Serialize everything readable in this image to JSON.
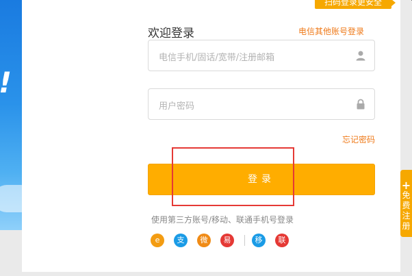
{
  "header": {
    "qr_tip": "扫码登录更安全"
  },
  "login": {
    "title": "欢迎登录",
    "other_account_link": "电信其他账号登录",
    "username_placeholder": "电信手机/固话/宽带/注册邮箱",
    "password_placeholder": "用户密码",
    "forgot_password": "忘记密码",
    "submit_label": "登录"
  },
  "third_party": {
    "label": "使用第三方账号/移动、联通手机号登录",
    "providers": [
      {
        "icon": "tianyi-icon",
        "color": "#f39c12"
      },
      {
        "icon": "alipay-icon",
        "color": "#1a9be6"
      },
      {
        "icon": "weibo-icon",
        "color": "#f08b16"
      },
      {
        "icon": "other-red-icon",
        "color": "#e53935"
      },
      {
        "icon": "china-mobile-icon",
        "color": "#1a9be6"
      },
      {
        "icon": "china-unicom-icon",
        "color": "#e53935"
      }
    ]
  },
  "side_tab": {
    "text": "免费注册"
  },
  "colors": {
    "accent": "#ffad00",
    "link": "#ef7a1a",
    "highlight": "#e53935"
  }
}
